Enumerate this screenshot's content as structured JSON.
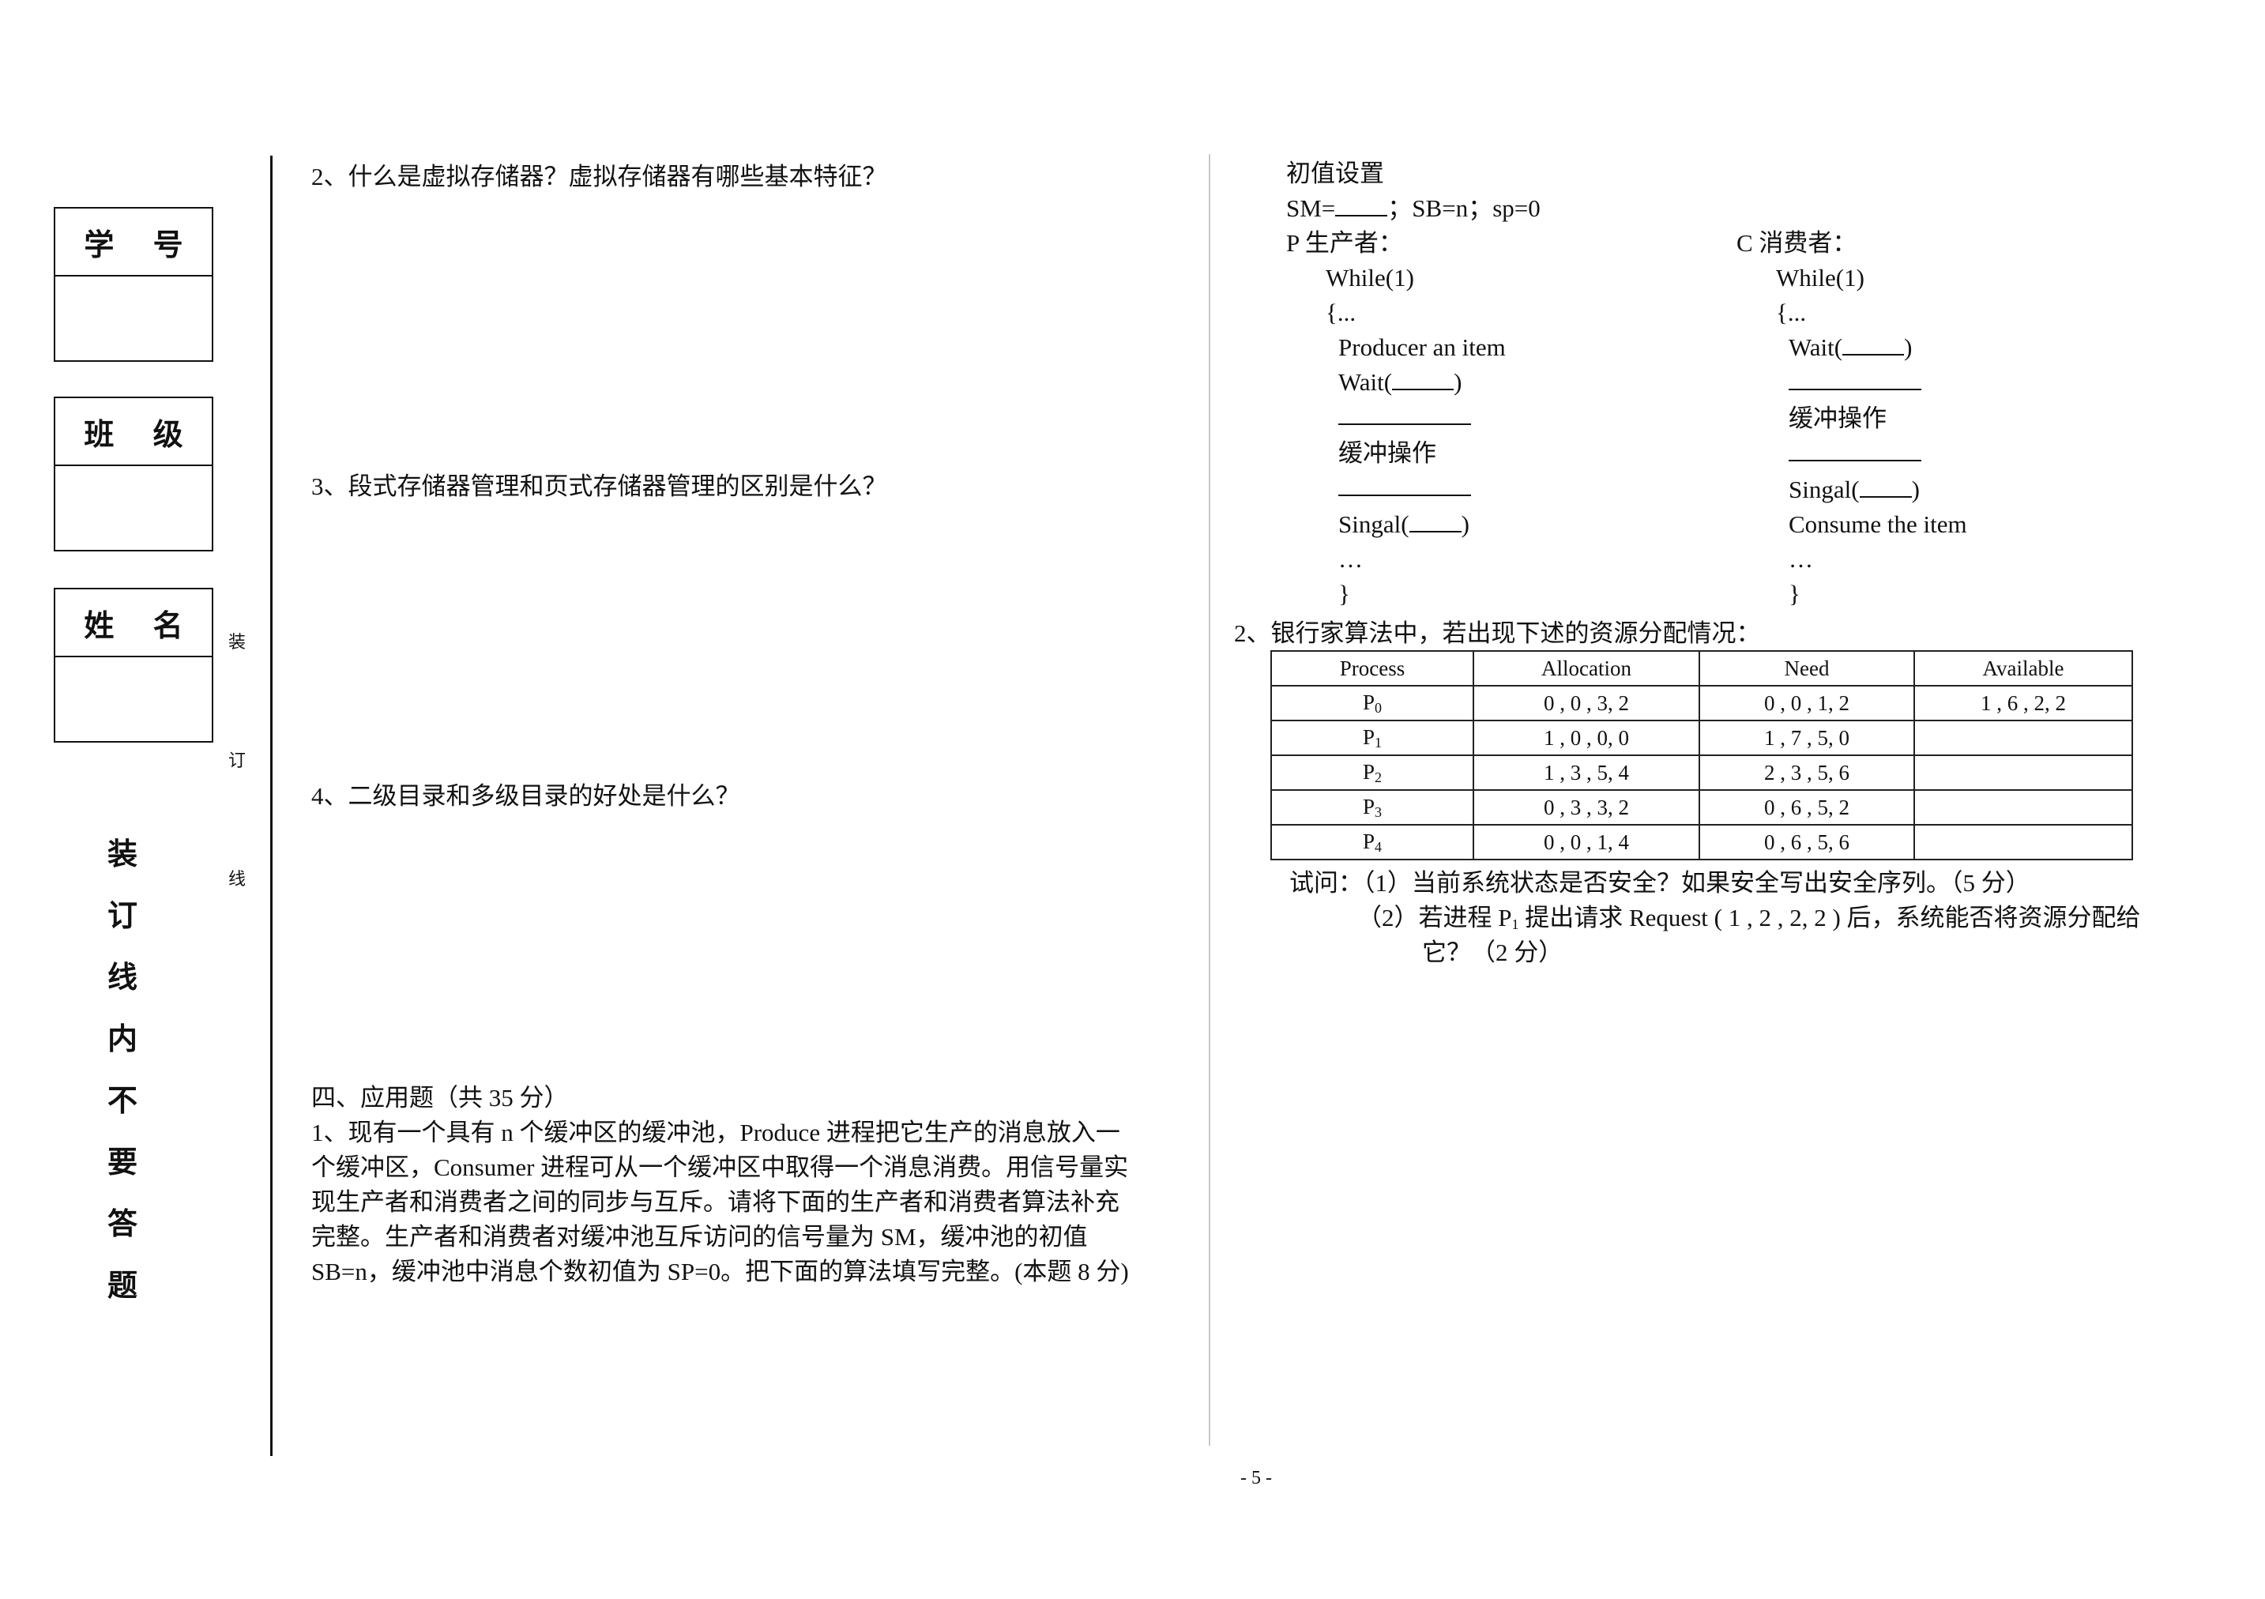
{
  "binding": {
    "fields": [
      {
        "label": "学 号",
        "value": ""
      },
      {
        "label": "班 级",
        "value": ""
      },
      {
        "label": "姓 名",
        "value": ""
      }
    ],
    "small_vertical": [
      "装",
      "订",
      "线"
    ],
    "big_vertical": [
      "装",
      "订",
      "线",
      "内",
      "不",
      "要",
      "答",
      "题"
    ]
  },
  "left_column": {
    "q2": "2、什么是虚拟存储器？虚拟存储器有哪些基本特征？",
    "q3": "3、段式存储器管理和页式存储器管理的区别是什么？",
    "q4": "4、二级目录和多级目录的好处是什么？",
    "section4_title": "四、应用题（共 35 分）",
    "app_q1_lines": [
      "1、现有一个具有 n 个缓冲区的缓冲池，Produce 进程把它生产的消息放入一",
      "个缓冲区，Consumer 进程可从一个缓冲区中取得一个消息消费。用信号量实",
      "现生产者和消费者之间的同步与互斥。请将下面的生产者和消费者算法补充",
      "完整。生产者和消费者对缓冲池互斥访问的信号量为 SM，缓冲池的初值",
      "SB=n，缓冲池中消息个数初值为 SP=0。把下面的算法填写完整。(本题 8 分)"
    ]
  },
  "right_column": {
    "init_title": "初值设置",
    "init_sm": "SM=",
    "init_rest": "；SB=n；sp=0",
    "producer": {
      "title": "P 生产者：",
      "while": "While(1)",
      "open": "{...",
      "produce": "Producer an item",
      "wait": "Wait(",
      "buffer_op": "缓冲操作",
      "signal": "Singal(",
      "close_paren": ")",
      "ellipsis": "…",
      "close": "}"
    },
    "consumer": {
      "title": "C 消费者：",
      "while": "While(1)",
      "open": "{...",
      "wait": "Wait(",
      "buffer_op": "缓冲操作",
      "signal": "Singal(",
      "close_paren": ")",
      "consume": "Consume the item",
      "ellipsis": "…",
      "close": "}"
    },
    "q2_title": "2、银行家算法中，若出现下述的资源分配情况：",
    "table": {
      "headers": [
        "Process",
        "Allocation",
        "Need",
        "Available"
      ],
      "rows": [
        {
          "proc": "P",
          "sub": "0",
          "allocation": "0 , 0 , 3, 2",
          "need": "0 , 0 , 1, 2",
          "available": "1 , 6 , 2, 2"
        },
        {
          "proc": "P",
          "sub": "1",
          "allocation": "1 , 0 , 0, 0",
          "need": "1 , 7 , 5, 0",
          "available": ""
        },
        {
          "proc": "P",
          "sub": "2",
          "allocation": "1 , 3 , 5, 4",
          "need": "2 , 3 , 5, 6",
          "available": ""
        },
        {
          "proc": "P",
          "sub": "3",
          "allocation": "0 , 3 , 3, 2",
          "need": "0 , 6 , 5, 2",
          "available": ""
        },
        {
          "proc": "P",
          "sub": "4",
          "allocation": "0 , 0 , 1, 4",
          "need": "0 , 6 , 5, 6",
          "available": ""
        }
      ]
    },
    "ask_1": "试问：（1）当前系统状态是否安全？如果安全写出安全序列。（5 分）",
    "ask_2_pre": "（2）若进程 P",
    "ask_2_sub": "1",
    "ask_2_post": " 提出请求  Request ( 1 , 2 , 2, 2 )  后，系统能否将资源分配给",
    "ask_2_cont": "它？（2 分）"
  },
  "footer": {
    "page_number": "- 5 -"
  }
}
